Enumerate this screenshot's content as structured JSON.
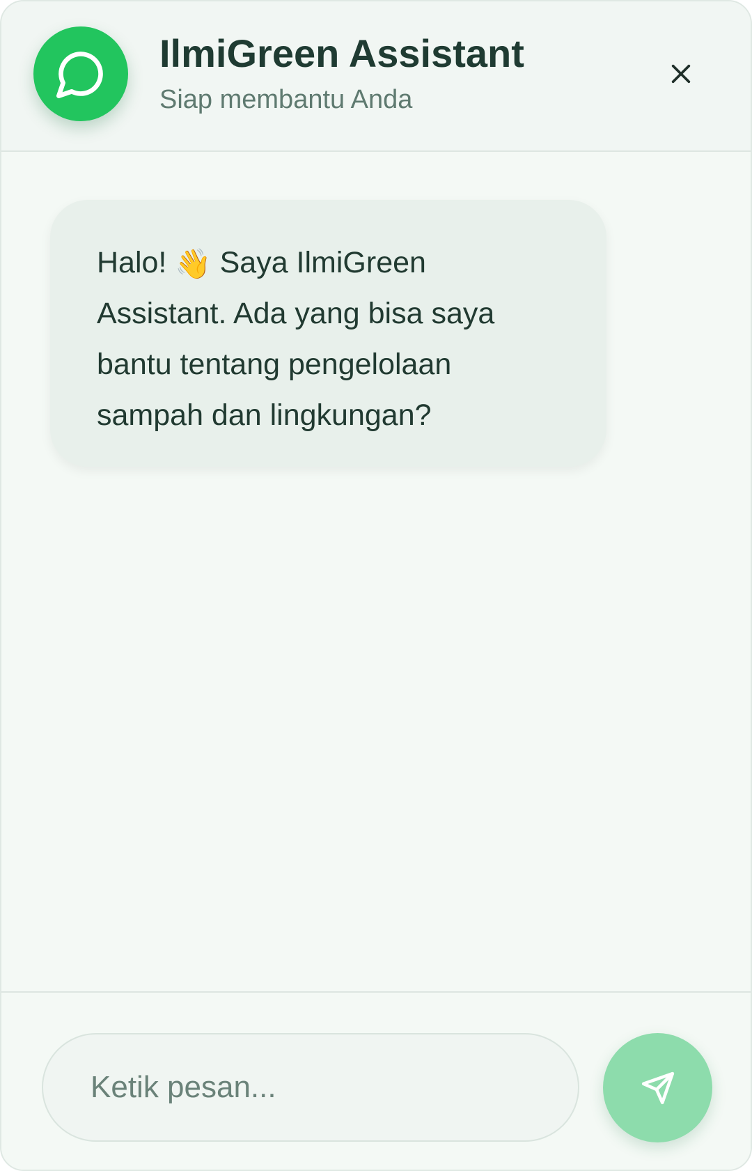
{
  "header": {
    "title": "IlmiGreen Assistant",
    "subtitle": "Siap membantu Anda",
    "avatar_icon": "message-circle-icon",
    "close_icon": "close-icon"
  },
  "messages": [
    {
      "sender": "assistant",
      "lines": [
        "Halo!",
        "Saya IlmiGreen",
        "Assistant. Ada yang bisa saya",
        "bantu tentang pengelolaan",
        "sampah dan lingkungan?"
      ],
      "emoji": "👋"
    }
  ],
  "composer": {
    "placeholder": "Ketik pesan...",
    "value": "",
    "send_icon": "send-icon"
  },
  "colors": {
    "brand": "#22c55e",
    "send_button": "#8ddcac",
    "bubble": "#e8f0eb",
    "background": "#f4f9f5"
  }
}
